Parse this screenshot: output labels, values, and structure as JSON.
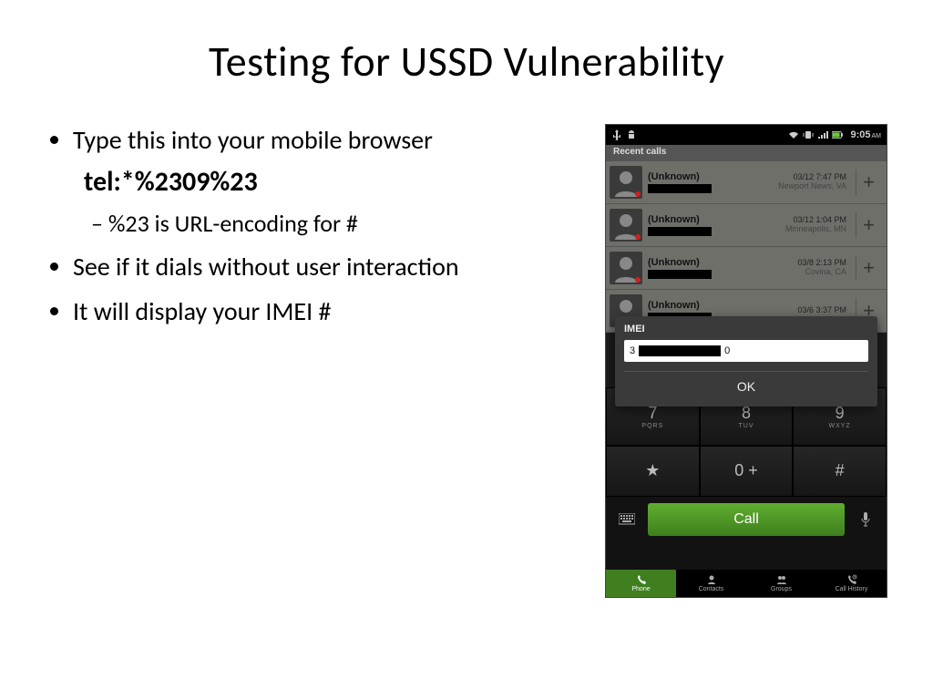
{
  "title": "Testing for USSD Vulnerability",
  "bullets": {
    "b1": "Type this into your mobile browser",
    "tel_code": "tel:*%2309%23",
    "sub1": "%23 is URL-encoding for #",
    "b2": "See if it dials without user interaction",
    "b3": "It will display your IMEI #"
  },
  "phone": {
    "status": {
      "time": "9:05",
      "ampm": "AM"
    },
    "section_label": "Recent calls",
    "calls": [
      {
        "name": "(Unknown)",
        "date": "03/12 7:47 PM",
        "loc": "Newport News, VA"
      },
      {
        "name": "(Unknown)",
        "date": "03/12 1:04 PM",
        "loc": "Minneapolis, MN"
      },
      {
        "name": "(Unknown)",
        "date": "03/8 2:13 PM",
        "loc": "Covina, CA"
      },
      {
        "name": "(Unknown)",
        "date": "03/6 3:37 PM",
        "loc": ""
      }
    ],
    "dialog": {
      "title": "IMEI",
      "leading": "3",
      "trailing": "0",
      "ok": "OK"
    },
    "dialpad": {
      "k7": "7",
      "k7s": "PQRS",
      "k8": "8",
      "k8s": "TUV",
      "k9": "9",
      "k9s": "WXYZ",
      "kstar": "★",
      "k0": "0 +",
      "khash": "#",
      "call": "Call"
    },
    "nav": {
      "phone": "Phone",
      "contacts": "Contacts",
      "groups": "Groups",
      "history": "Call History"
    }
  }
}
